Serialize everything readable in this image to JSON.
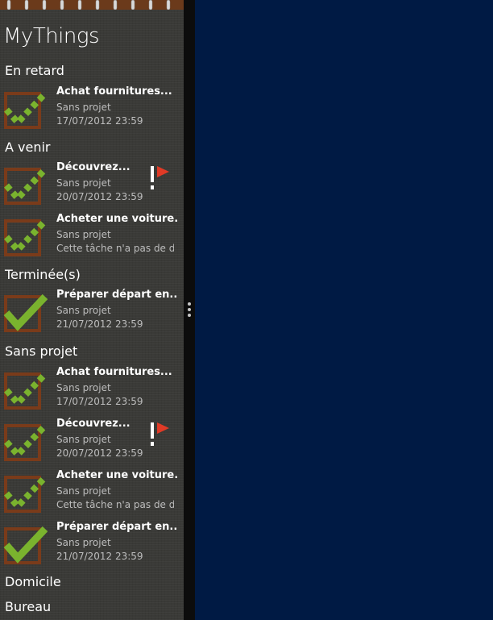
{
  "app": {
    "title": "MyThings"
  },
  "groups": [
    {
      "header": "En retard",
      "tasks": [
        {
          "title": "Achat fournitures...",
          "project": "Sans projet",
          "due": "17/07/2012 23:59",
          "status": "pending",
          "flagged": false
        }
      ]
    },
    {
      "header": "A venir",
      "tasks": [
        {
          "title": "Découvrez...",
          "project": "Sans projet",
          "due": "20/07/2012 23:59",
          "status": "pending",
          "flagged": true
        },
        {
          "title": "Acheter une voiture...",
          "project": "Sans projet",
          "due": "Cette tâche n'a pas de date",
          "status": "pending",
          "flagged": false
        }
      ]
    },
    {
      "header": "Terminée(s)",
      "tasks": [
        {
          "title": "Préparer départ en...",
          "project": "Sans projet",
          "due": "21/07/2012 23:59",
          "status": "done",
          "flagged": false
        }
      ]
    },
    {
      "header": "Sans projet",
      "tasks": [
        {
          "title": "Achat fournitures...",
          "project": "Sans projet",
          "due": "17/07/2012 23:59",
          "status": "pending",
          "flagged": false
        },
        {
          "title": "Découvrez...",
          "project": "Sans projet",
          "due": "20/07/2012 23:59",
          "status": "pending",
          "flagged": true
        },
        {
          "title": "Acheter une voiture...",
          "project": "Sans projet",
          "due": "Cette tâche n'a pas de date",
          "status": "pending",
          "flagged": false
        },
        {
          "title": "Préparer départ en...",
          "project": "Sans projet",
          "due": "21/07/2012 23:59",
          "status": "done",
          "flagged": false
        }
      ]
    },
    {
      "header": "Domicile",
      "tasks": []
    },
    {
      "header": "Bureau",
      "tasks": []
    }
  ],
  "icons": {
    "pending": "dashed-check-icon",
    "done": "check-icon",
    "flag": "priority-flag-icon"
  },
  "colors": {
    "pane_background": "#3a3a37",
    "right_background": "#001a44",
    "check_green": "#7ab32e",
    "box_brown": "#7a3b1a",
    "flag_red": "#e03a26",
    "binding_brown": "#6b3a1b"
  }
}
